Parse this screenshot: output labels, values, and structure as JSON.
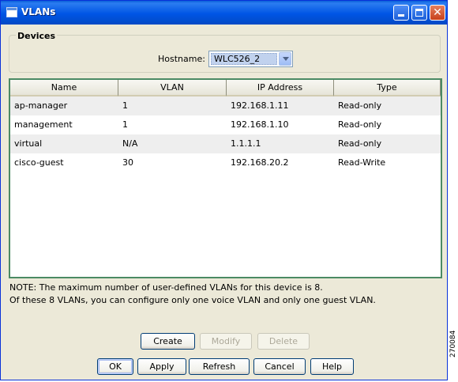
{
  "window": {
    "title": "VLANs"
  },
  "devices": {
    "legend": "Devices",
    "hostname_label": "Hostname:",
    "hostname_value": "WLC526_2"
  },
  "table": {
    "columns": [
      "Name",
      "VLAN",
      "IP Address",
      "Type"
    ],
    "rows": [
      {
        "name": "ap-manager",
        "vlan": "1",
        "ip": "192.168.1.11",
        "type": "Read-only"
      },
      {
        "name": "management",
        "vlan": "1",
        "ip": "192.168.1.10",
        "type": "Read-only"
      },
      {
        "name": "virtual",
        "vlan": "N/A",
        "ip": "1.1.1.1",
        "type": "Read-only"
      },
      {
        "name": "cisco-guest",
        "vlan": "30",
        "ip": "192.168.20.2",
        "type": "Read-Write"
      }
    ]
  },
  "note": {
    "line1": "NOTE: The maximum number of user-defined VLANs for this device is 8.",
    "line2": "Of these 8 VLANs, you can configure only one voice VLAN and only one guest VLAN."
  },
  "actions": {
    "create": "Create",
    "modify": "Modify",
    "delete": "Delete"
  },
  "footer": {
    "ok": "OK",
    "apply": "Apply",
    "refresh": "Refresh",
    "cancel": "Cancel",
    "help": "Help"
  },
  "figure_id": "270084",
  "colors": {
    "titlebar": "#0055e5",
    "dialog_bg": "#ece9d8",
    "table_border": "#4b8a64",
    "alt_row": "#eeeeee"
  }
}
